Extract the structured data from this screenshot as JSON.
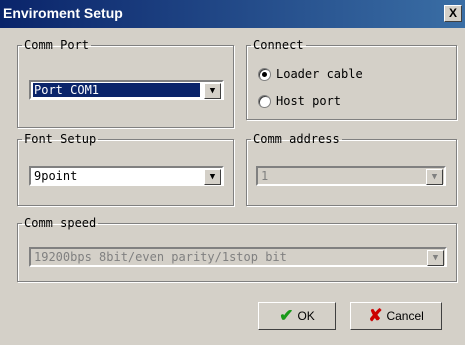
{
  "window": {
    "title": "Enviroment Setup",
    "close_label": "X"
  },
  "comm_port": {
    "legend": "Comm Port",
    "value": "Port COM1"
  },
  "connect": {
    "legend": "Connect",
    "options": [
      "Loader cable",
      "Host port"
    ],
    "selected": "Loader cable"
  },
  "font_setup": {
    "legend": "Font Setup",
    "value": "9point"
  },
  "comm_address": {
    "legend": "Comm address",
    "value": "1"
  },
  "comm_speed": {
    "legend": "Comm speed",
    "value": "19200bps 8bit/even parity/1stop bit"
  },
  "buttons": {
    "ok_label": "OK",
    "cancel_label": "Cancel"
  },
  "icons": {
    "ok": "checkmark-icon",
    "cancel": "x-icon",
    "dropdown": "chevron-down-icon"
  }
}
